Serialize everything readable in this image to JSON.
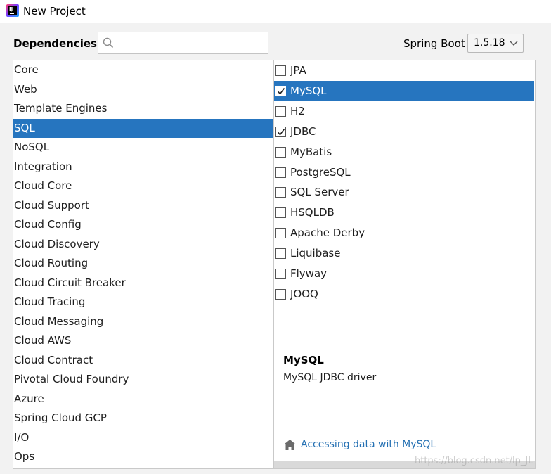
{
  "window": {
    "title": "New Project"
  },
  "header": {
    "dependencies_label": "Dependencies",
    "search_placeholder": "",
    "search_value": "",
    "spring_boot_label": "Spring Boot",
    "spring_boot_version": "1.5.18"
  },
  "categories": [
    "Core",
    "Web",
    "Template Engines",
    "SQL",
    "NoSQL",
    "Integration",
    "Cloud Core",
    "Cloud Support",
    "Cloud Config",
    "Cloud Discovery",
    "Cloud Routing",
    "Cloud Circuit Breaker",
    "Cloud Tracing",
    "Cloud Messaging",
    "Cloud AWS",
    "Cloud Contract",
    "Pivotal Cloud Foundry",
    "Azure",
    "Spring Cloud GCP",
    "I/O",
    "Ops"
  ],
  "selected_category": "SQL",
  "dependencies": [
    {
      "label": "JPA",
      "checked": false
    },
    {
      "label": "MySQL",
      "checked": true,
      "selected": true
    },
    {
      "label": "H2",
      "checked": false
    },
    {
      "label": "JDBC",
      "checked": true
    },
    {
      "label": "MyBatis",
      "checked": false
    },
    {
      "label": "PostgreSQL",
      "checked": false
    },
    {
      "label": "SQL Server",
      "checked": false
    },
    {
      "label": "HSQLDB",
      "checked": false
    },
    {
      "label": "Apache Derby",
      "checked": false
    },
    {
      "label": "Liquibase",
      "checked": false
    },
    {
      "label": "Flyway",
      "checked": false
    },
    {
      "label": "JOOQ",
      "checked": false
    }
  ],
  "detail": {
    "title": "MySQL",
    "description": "MySQL JDBC driver",
    "link_text": "Accessing data with MySQL"
  },
  "watermark": "https://blog.csdn.net/lp_JL",
  "colors": {
    "selection": "#2675bf",
    "link": "#2470b3"
  }
}
